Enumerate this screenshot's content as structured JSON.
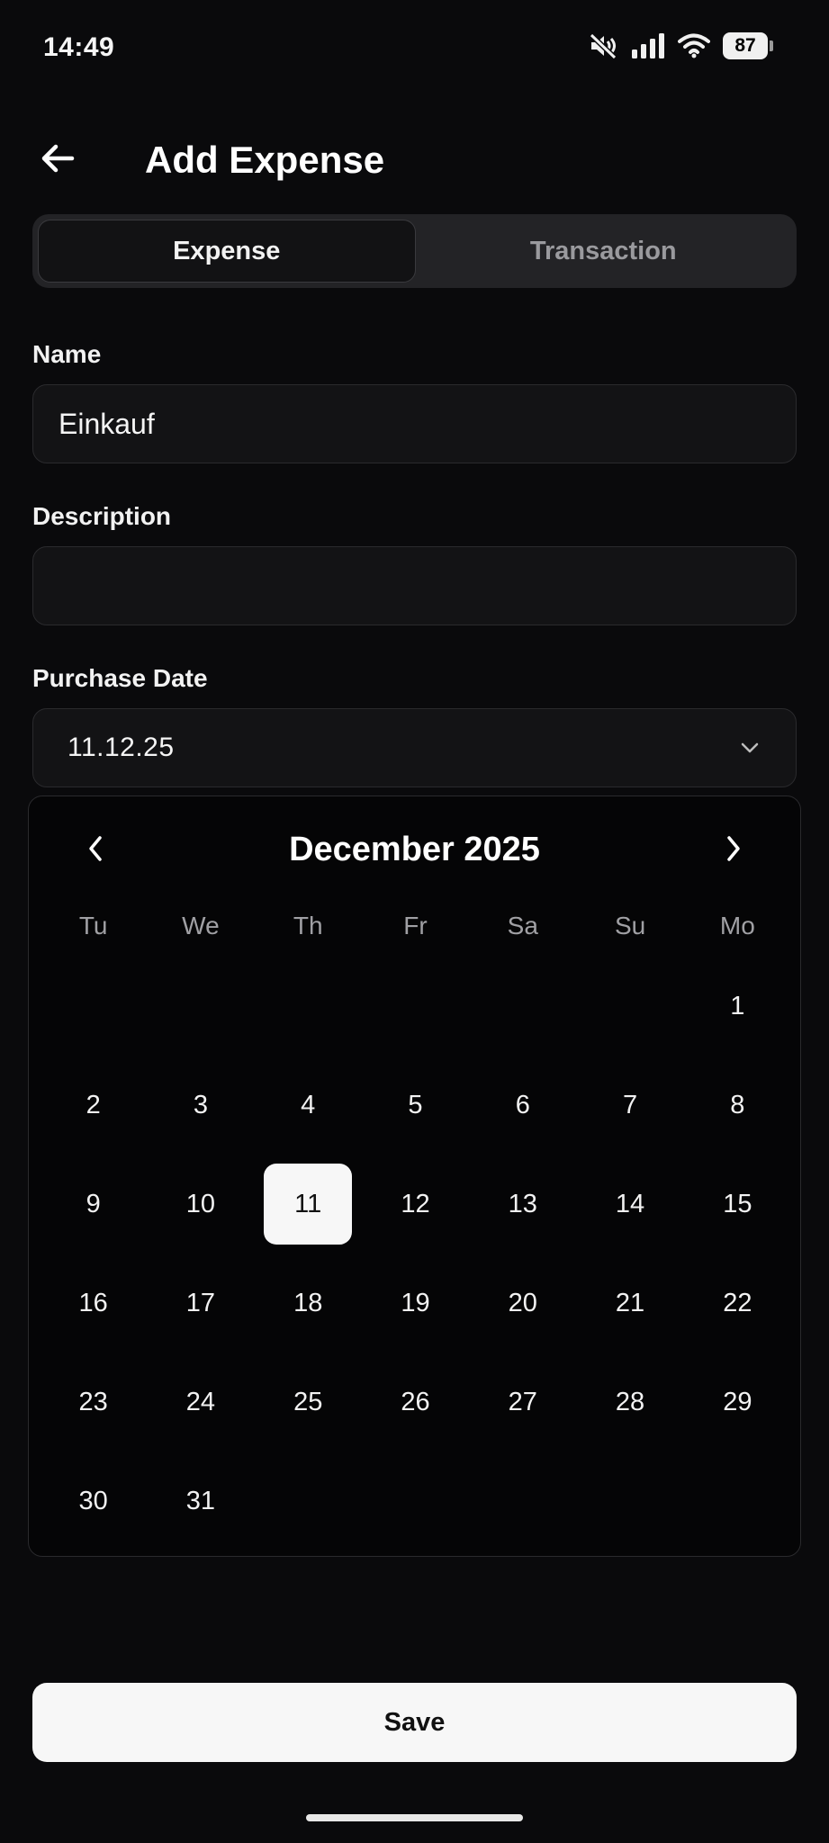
{
  "status_bar": {
    "time": "14:49",
    "battery": "87",
    "icons": [
      "mute-icon",
      "signal-icon",
      "wifi-icon",
      "battery-icon"
    ]
  },
  "app_bar": {
    "title": "Add Expense",
    "back_icon": "arrow-left-icon"
  },
  "tabs": [
    {
      "label": "Expense",
      "active": true
    },
    {
      "label": "Transaction",
      "active": false
    }
  ],
  "form": {
    "name": {
      "label": "Name",
      "value": "Einkauf",
      "placeholder": ""
    },
    "description": {
      "label": "Description",
      "value": "",
      "placeholder": ""
    },
    "purchase_date": {
      "label": "Purchase Date",
      "value": "11.12.25",
      "icon": "chevron-down-icon"
    }
  },
  "calendar": {
    "month_title": "December 2025",
    "weekdays": [
      "Tu",
      "We",
      "Th",
      "Fr",
      "Sa",
      "Su",
      "Mo"
    ],
    "leading_blanks": 6,
    "days_in_month": 31,
    "selected_day": 11,
    "prev_icon": "chevron-left-icon",
    "next_icon": "chevron-right-icon"
  },
  "save_label": "Save",
  "colors": {
    "background": "#0a0a0c",
    "surface": "#131315",
    "selected_day_bg": "#f7f7f7",
    "button_bg": "#f7f7f7"
  }
}
